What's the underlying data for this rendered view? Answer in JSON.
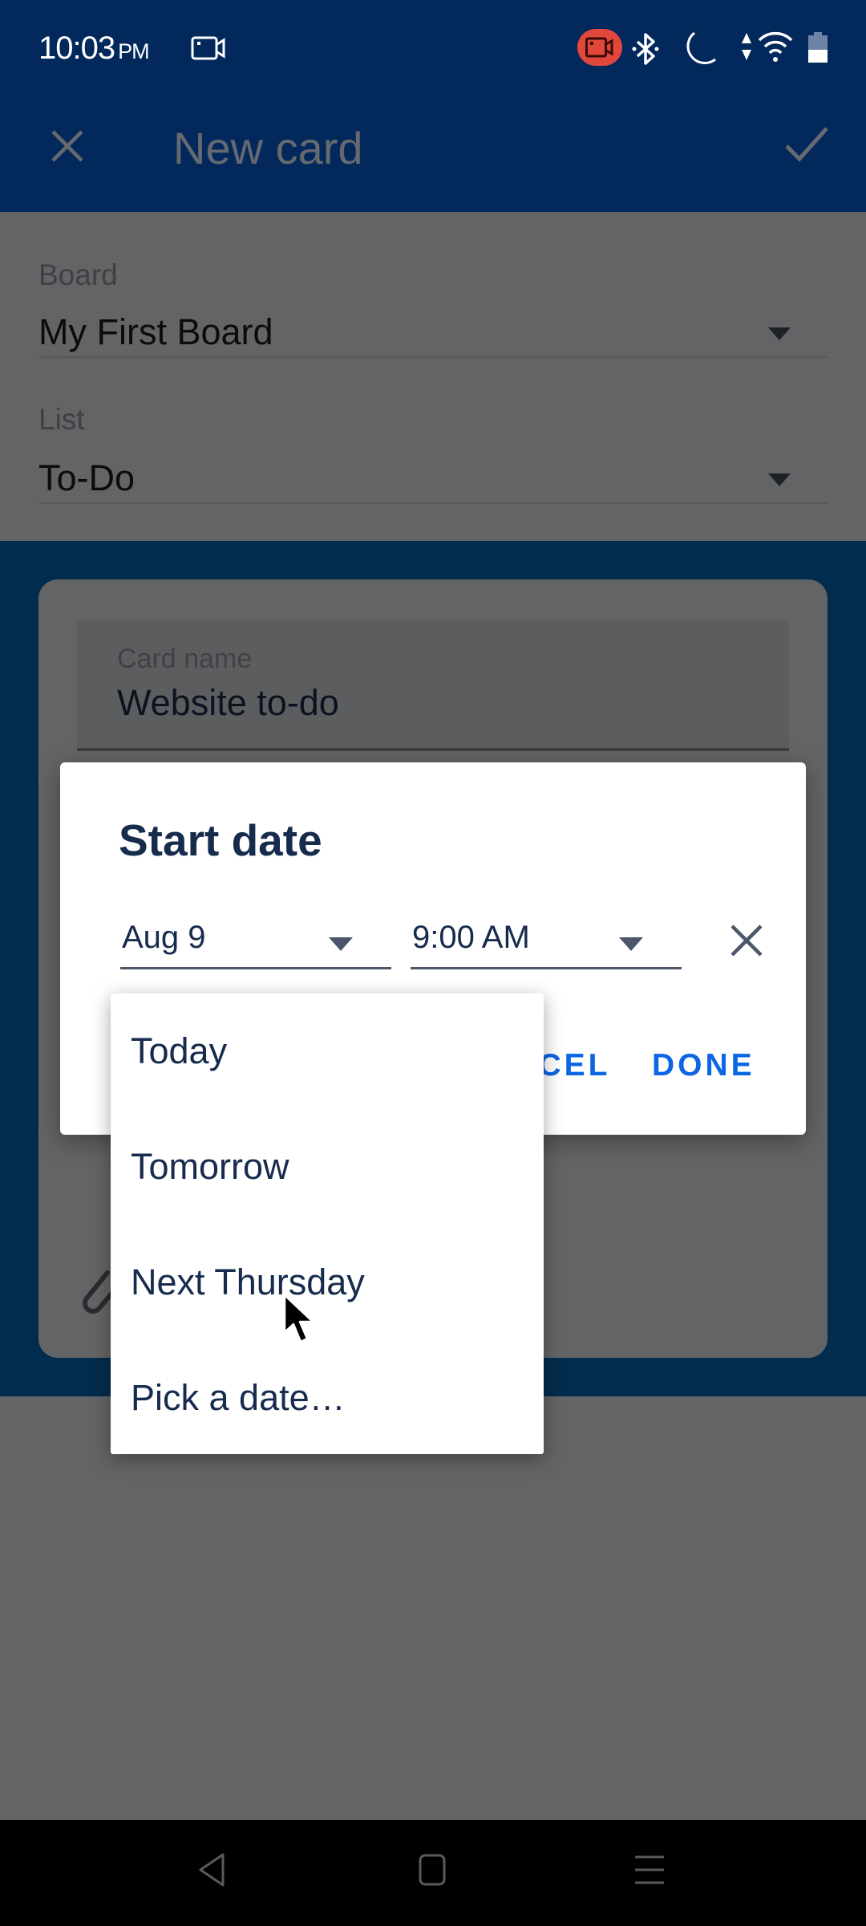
{
  "status_bar": {
    "time": "10:03",
    "ampm": "PM",
    "icons": [
      "screen-record-icon",
      "recording-indicator-icon",
      "bluetooth-icon",
      "do-not-disturb-moon-icon",
      "data-arrows-icon",
      "wifi-icon",
      "battery-icon"
    ]
  },
  "app_bar": {
    "title": "New card",
    "close_icon": "close-icon",
    "confirm_icon": "check-icon"
  },
  "form": {
    "board_label": "Board",
    "board_value": "My First Board",
    "list_label": "List",
    "list_value": "To-Do",
    "card_name_label": "Card name",
    "card_name_value": "Website to-do"
  },
  "dialog": {
    "title": "Start date",
    "date_value": "Aug 9",
    "time_value": "9:00 AM",
    "cancel_label": "CANCEL",
    "done_label": "DONE"
  },
  "date_menu": {
    "items": [
      "Today",
      "Tomorrow",
      "Next Thursday",
      "Pick a date…"
    ]
  },
  "colors": {
    "app_bar": "#03295c",
    "accent": "#0c66e4",
    "text_primary": "#172b4d",
    "recording": "#e1473a"
  }
}
